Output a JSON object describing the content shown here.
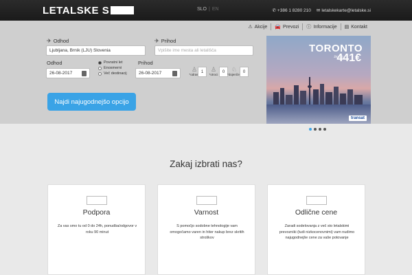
{
  "header": {
    "logo_text": "LETALSKE S",
    "lang_active": "SLO",
    "lang_sep": "|",
    "lang_inactive": "EN",
    "phone": "+386 1 8280 210",
    "email": "letalskekarte@letalske.si"
  },
  "subnav": {
    "items": [
      "Akcije",
      "Prevozi",
      "Informacije",
      "Kontakt"
    ]
  },
  "search": {
    "from_label": "Odhod",
    "from_value": "Ljubljana, Brnik (LJU) Slovenia",
    "to_label": "Prihod",
    "to_placeholder": "Vpišite ime mesta ali letališča",
    "depart_label": "Odhod",
    "depart_value": "26-08-2017",
    "return_label": "Prihod",
    "return_value": "26-08-2017",
    "trip_options": [
      "Povratni let",
      "Enosmerni",
      "Več destinacij"
    ],
    "passengers": [
      {
        "label": "*odrasli",
        "value": "1"
      },
      {
        "label": "*otroci",
        "value": "0"
      },
      {
        "label": "*dojenček",
        "value": "0"
      }
    ],
    "button_label": "Najdi najugodnejšo opcijo"
  },
  "banner": {
    "title": "TORONTO",
    "from_text": "ŽE OD",
    "price": "441€",
    "brand": "transat",
    "dots_count": 4,
    "active_dot": 0
  },
  "why": {
    "title": "Zakaj izbrati nas?",
    "cards": [
      {
        "title": "Podpora",
        "text": "Za vas smo tu od 0 do 24h, ponudba/odgovor v roku 90 minut"
      },
      {
        "title": "Varnost",
        "text": "S pomočjo sodobne tehnologije vam omogočamo varen in hiter nakup brez skritih stroškov"
      },
      {
        "title": "Odlične cene",
        "text": "Zaradi sodelovanja z več sto letalskimi prevozniki (tudi nizkocenovnimi) vam nudimo najugodnejše cene za vaše potovanje"
      }
    ]
  },
  "colors": {
    "topbar": "#1f1f1f",
    "search_bg": "#cfcfcf",
    "accent": "#3aa3e6",
    "page_bg": "#e9e9e9"
  }
}
